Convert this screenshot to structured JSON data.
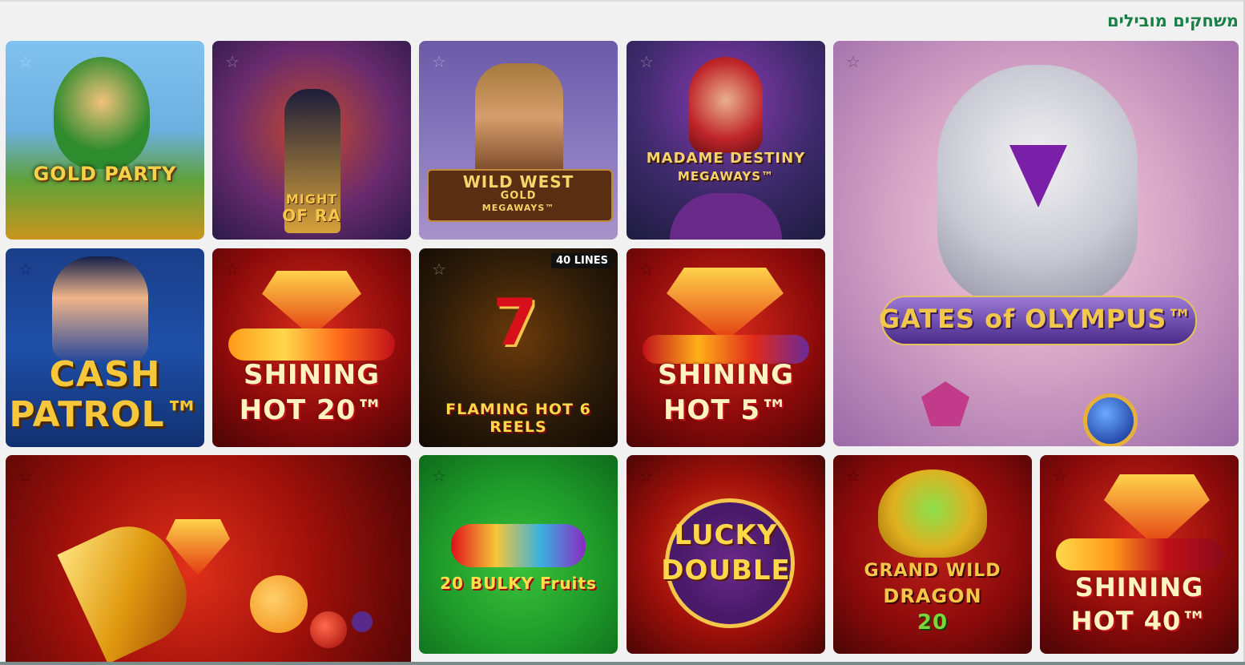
{
  "section": {
    "title": "משחקים מובילים"
  },
  "games": {
    "gold_party": {
      "title": "GOLD PARTY"
    },
    "might_of_ra": {
      "title_line1": "MIGHT",
      "title_line2": "OF RA"
    },
    "wild_west": {
      "title_line1": "WILD WEST",
      "title_line2": "GOLD",
      "title_line3": "MEGAWAYS™"
    },
    "madame_destiny": {
      "title_line1": "MADAME DESTINY",
      "title_line2": "MEGAWAYS™"
    },
    "gates_of_olympus": {
      "title": "GATES of OLYMPUS™"
    },
    "cash_patrol": {
      "title_line1": "CASH",
      "title_line2": "PATROL™"
    },
    "shining_hot_20": {
      "title_line1": "SHINING",
      "title_line2": "HOT 20™"
    },
    "flaming_hot_6": {
      "badge": "40 LINES",
      "title": "FLAMING HOT 6 REELS"
    },
    "shining_hot_5": {
      "title_line1": "SHINING",
      "title_line2": "HOT 5™"
    },
    "burning_fruits": {
      "title": ""
    },
    "bulky_fruits": {
      "title": "20 BULKY Fruits"
    },
    "lucky_double": {
      "title_line1": "LUCKY",
      "title_line2": "DOUBLE"
    },
    "grand_wild_dragon": {
      "title_line1": "GRAND WILD",
      "title_line2": "DRAGON",
      "title_line3": "20"
    },
    "shining_hot_40": {
      "title_line1": "SHINING",
      "title_line2": "HOT 40™"
    }
  }
}
